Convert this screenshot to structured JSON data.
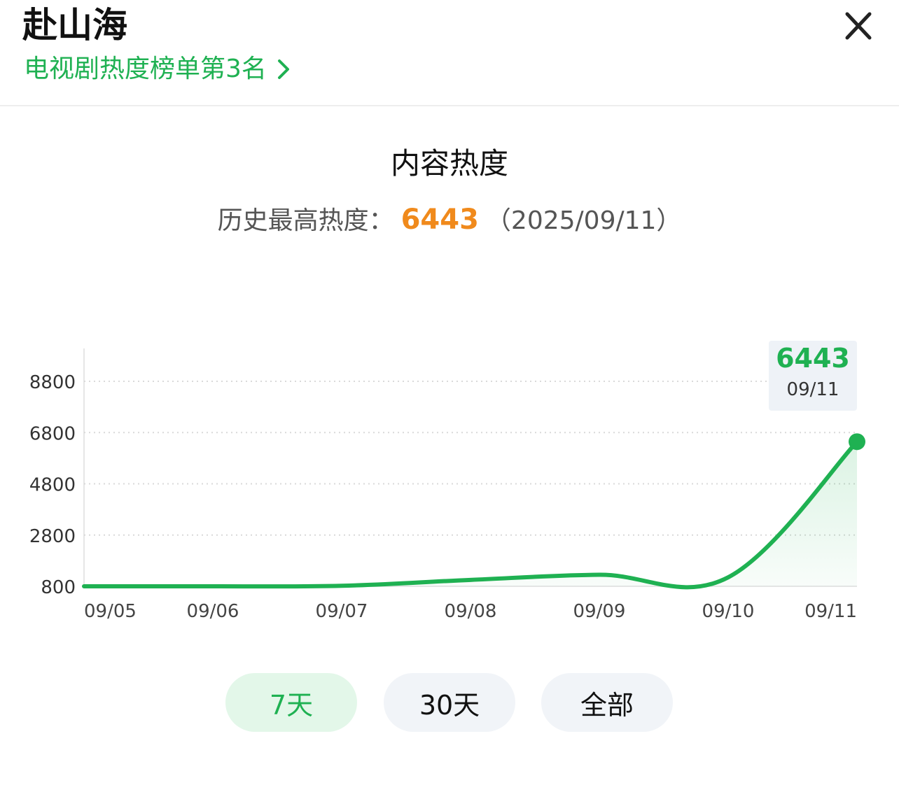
{
  "header": {
    "title": "赴山海",
    "rank_link": "电视剧热度榜单第3名"
  },
  "section": {
    "title": "内容热度",
    "peak_label": "历史最高热度：",
    "peak_value": "6443",
    "peak_date": "（2025/09/11）"
  },
  "tooltip": {
    "value": "6443",
    "date": "09/11"
  },
  "range_tabs": [
    {
      "label": "7天",
      "active": true
    },
    {
      "label": "30天",
      "active": false
    },
    {
      "label": "全部",
      "active": false
    }
  ],
  "colors": {
    "accent": "#1fb152",
    "peak": "#f08a1c"
  },
  "chart_data": {
    "type": "area",
    "categories": [
      "09/05",
      "09/06",
      "09/07",
      "09/08",
      "09/09",
      "09/10",
      "09/11"
    ],
    "values": [
      800,
      800,
      820,
      1050,
      1250,
      1150,
      6443
    ],
    "yticks": [
      800,
      2800,
      4800,
      6800,
      8800
    ],
    "ylim": [
      800,
      10200
    ],
    "grid": true,
    "title": "",
    "xlabel": "",
    "ylabel": ""
  }
}
